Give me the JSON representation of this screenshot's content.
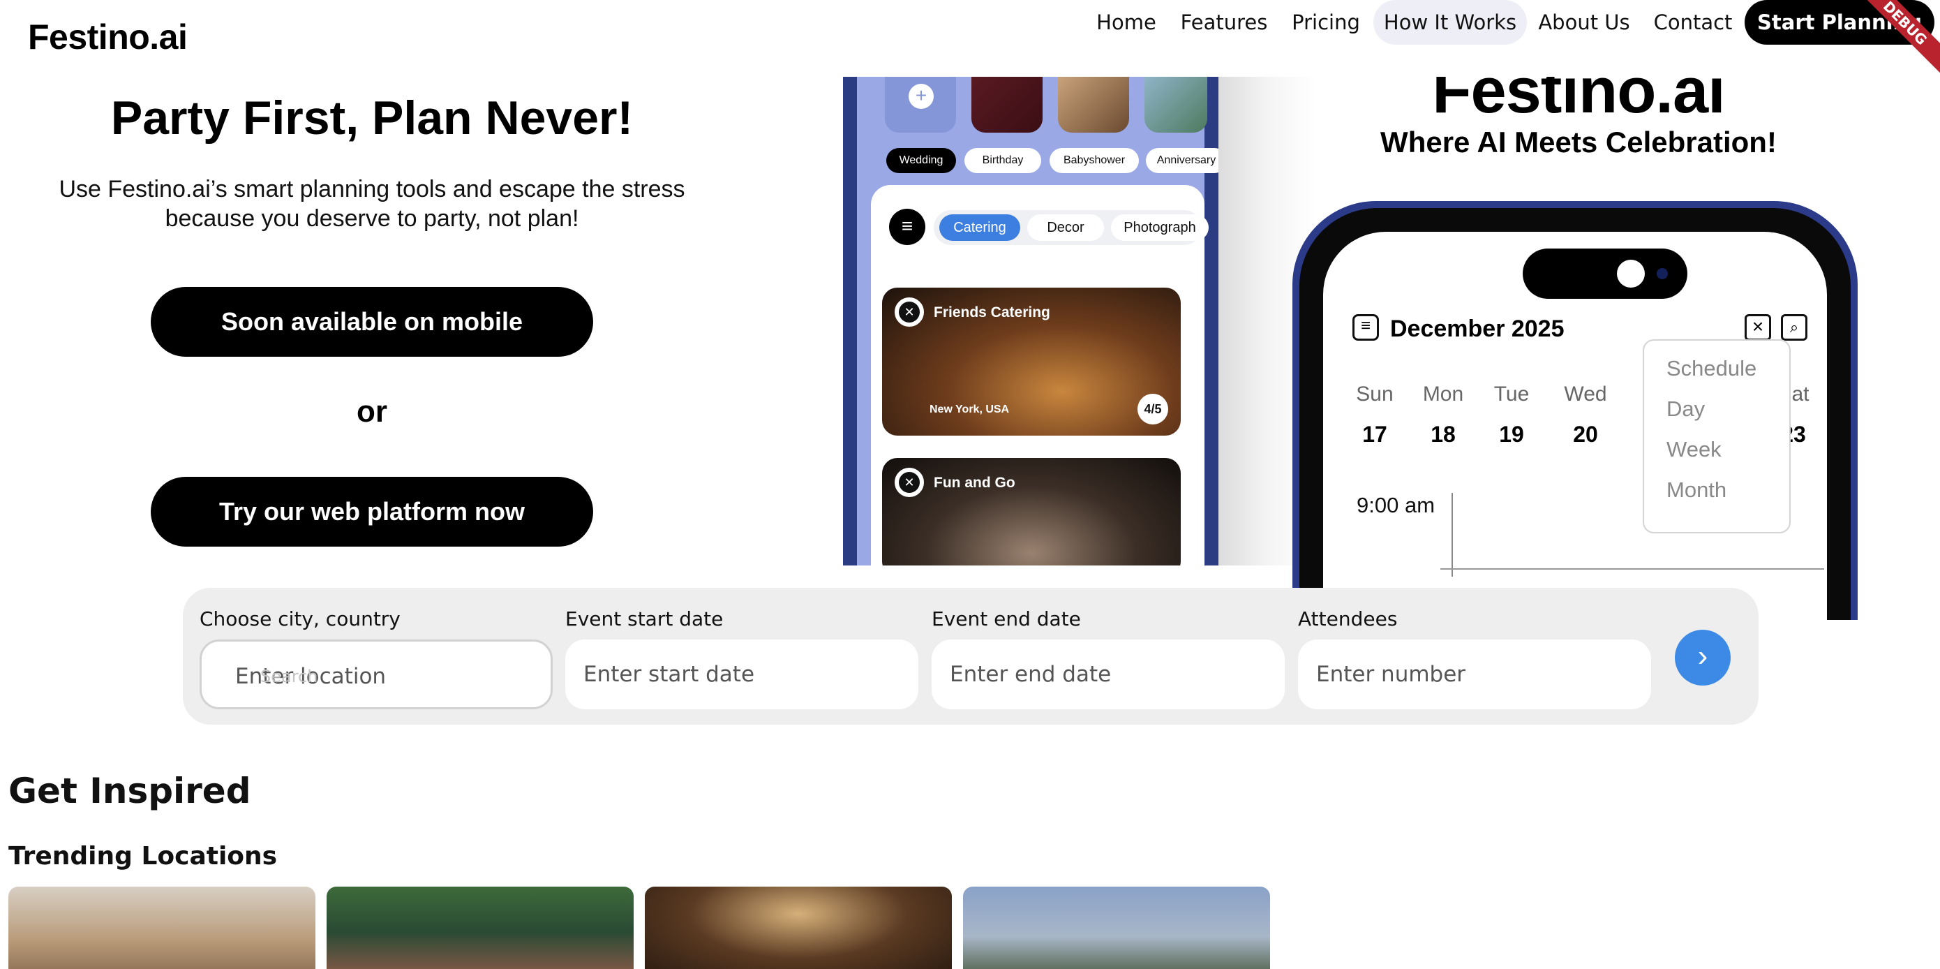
{
  "nav": {
    "logo": "Festino.ai",
    "links": [
      "Home",
      "Features",
      "Pricing",
      "How It Works",
      "About Us",
      "Contact"
    ],
    "active": "How It Works",
    "cta": "Start Planning",
    "debug_banner": "DEBUG"
  },
  "hero": {
    "title": "Party First, Plan Never!",
    "subtitle": "Use Festino.ai’s smart planning tools and escape the stress because you deserve to party, not plan!",
    "mobile_button": "Soon available on mobile",
    "or_text": "or",
    "web_button": "Try our web platform now"
  },
  "phone_left": {
    "add_icon": "+",
    "event_tags": [
      "Wedding",
      "Birthday",
      "Babyshower",
      "Anniversary"
    ],
    "selected_tag": "Wedding",
    "categories": [
      "Catering",
      "Decor",
      "Photograph"
    ],
    "selected_category": "Catering",
    "cards": [
      {
        "title": "Friends Catering",
        "location": "New York, USA",
        "rating": "4/5"
      },
      {
        "title": "Fun and Go",
        "location": "",
        "rating": ""
      }
    ]
  },
  "brand": {
    "name": "Festino.ai",
    "tagline": "Where AI Meets Celebration!"
  },
  "phone_right": {
    "month": "December 2025",
    "days": [
      "Sun",
      "Mon",
      "Tue",
      "Wed",
      "Sat"
    ],
    "dates": [
      "17",
      "18",
      "19",
      "20",
      "23"
    ],
    "time": "9:00 am",
    "view_options": [
      "Schedule",
      "Day",
      "Week",
      "Month"
    ]
  },
  "search": {
    "location": {
      "label": "Choose city, country",
      "placeholder": "Enter location",
      "overlay_hint": "Search"
    },
    "start": {
      "label": "Event start date",
      "placeholder": "Enter start date"
    },
    "end": {
      "label": "Event end date",
      "placeholder": "Enter end date"
    },
    "attendees": {
      "label": "Attendees",
      "placeholder": "Enter number"
    },
    "submit_icon": "chevron-right-icon"
  },
  "inspired": {
    "heading": "Get Inspired",
    "subheading": "Trending Locations"
  },
  "colors": {
    "accent_blue": "#3c8ae6",
    "phone_frame": "#2b3b8a",
    "nav_active_bg": "#eeeef6",
    "search_bg": "#eeeeee"
  }
}
